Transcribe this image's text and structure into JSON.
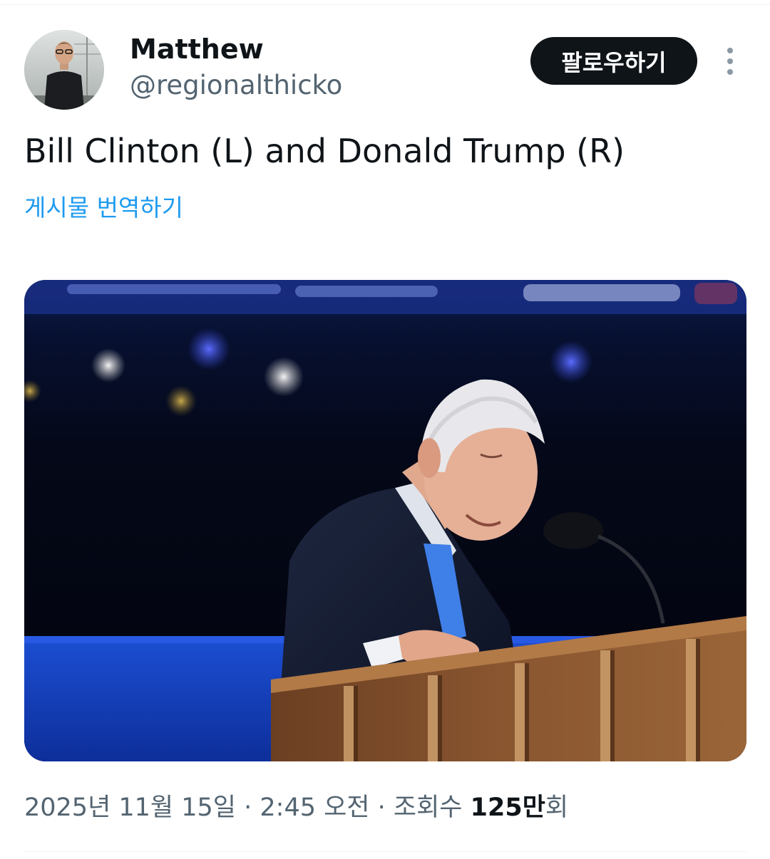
{
  "user": {
    "display_name": "Matthew",
    "handle": "@regionalthicko"
  },
  "actions": {
    "follow_label": "팔로우하기",
    "more_icon": "more-vertical-icon"
  },
  "tweet": {
    "text": "Bill Clinton (L) and Donald Trump (R)",
    "translate_label": "게시물 번역하기"
  },
  "meta": {
    "date": "2025년 11월 15일",
    "separator": " · ",
    "time": "2:45 오전",
    "views_label": "조회수",
    "views_count": "125만",
    "views_suffix": "회"
  },
  "colors": {
    "accent": "#1d9bf0",
    "follow_bg": "#0f1419",
    "secondary_text": "#536471"
  }
}
